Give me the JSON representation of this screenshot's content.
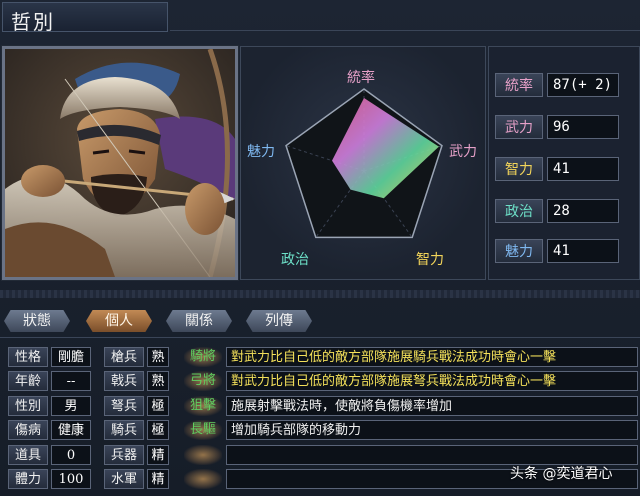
{
  "general": {
    "name": "哲別"
  },
  "radar": {
    "labels": {
      "lead": "統率",
      "war": "武力",
      "int": "智力",
      "pol": "政治",
      "cha": "魅力"
    },
    "values": {
      "lead": 89,
      "war": 96,
      "int": 41,
      "pol": 28,
      "cha": 41
    },
    "max": 100,
    "colors": {
      "lead": "#e6a0c8",
      "war": "#e6a0c8",
      "int": "#f3d55a",
      "pol": "#6de0c8",
      "cha": "#7fb8f0"
    }
  },
  "stats": [
    {
      "label": "統率",
      "value": "87(+ 2)",
      "color": "#e6a0c8"
    },
    {
      "label": "武力",
      "value": "96",
      "color": "#e6a0c8"
    },
    {
      "label": "智力",
      "value": "41",
      "color": "#f3d55a"
    },
    {
      "label": "政治",
      "value": "28",
      "color": "#6de0c8"
    },
    {
      "label": "魅力",
      "value": "41",
      "color": "#7fb8f0"
    }
  ],
  "tabs": [
    {
      "label": "狀態",
      "active": false
    },
    {
      "label": "個人",
      "active": true
    },
    {
      "label": "關係",
      "active": false
    },
    {
      "label": "列傳",
      "active": false
    }
  ],
  "personal": [
    {
      "label": "性格",
      "value": "剛膽"
    },
    {
      "label": "年齡",
      "value": "--"
    },
    {
      "label": "性別",
      "value": "男"
    },
    {
      "label": "傷病",
      "value": "健康"
    },
    {
      "label": "道具",
      "value": "0"
    },
    {
      "label": "體力",
      "value": "100"
    }
  ],
  "aptitude": [
    {
      "label": "槍兵",
      "value": "熟"
    },
    {
      "label": "戟兵",
      "value": "熟"
    },
    {
      "label": "弩兵",
      "value": "極"
    },
    {
      "label": "騎兵",
      "value": "極"
    },
    {
      "label": "兵器",
      "value": "精"
    },
    {
      "label": "水軍",
      "value": "精"
    }
  ],
  "skills": [
    {
      "name": "騎將",
      "desc": "對武力比自己低的敵方部隊施展騎兵戰法成功時會心一擊"
    },
    {
      "name": "弓將",
      "desc": "對武力比自己低的敵方部隊施展弩兵戰法成功時會心一擊"
    },
    {
      "name": "狙擊",
      "desc": "施展射擊戰法時，使敵將負傷機率增加"
    },
    {
      "name": "長驅",
      "desc": "增加騎兵部隊的移動力"
    },
    {
      "name": "",
      "desc": ""
    },
    {
      "name": "",
      "desc": ""
    }
  ],
  "watermark": "头条 @奕道君心"
}
